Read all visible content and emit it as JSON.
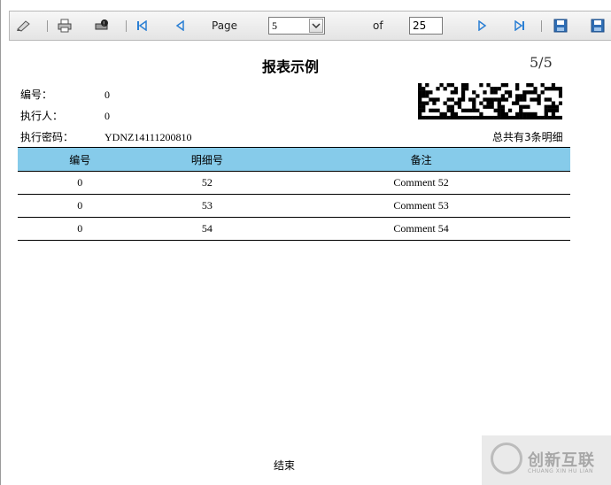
{
  "toolbar": {
    "page_label": "Page",
    "current_page": "5",
    "of_label": "of",
    "total_pages": "25"
  },
  "report": {
    "title": "报表示例",
    "page_indicator": "5/5",
    "fields": [
      {
        "label": "编号：",
        "value": "0"
      },
      {
        "label": "执行人：",
        "value": "0"
      },
      {
        "label": "执行密码：",
        "value": "YDNZ14111200810"
      }
    ],
    "summary": "总共有3条明细",
    "table": {
      "headers": [
        "编号",
        "明细号",
        "备注"
      ],
      "rows": [
        [
          "0",
          "52",
          "Comment 52"
        ],
        [
          "0",
          "53",
          "Comment 53"
        ],
        [
          "0",
          "54",
          "Comment 54"
        ]
      ]
    },
    "footer": "结束"
  },
  "watermark": {
    "brand": "创新互联",
    "sub": "CHUANG XIN HU LIAN"
  },
  "colors": {
    "header_bg": "#86cbea",
    "nav_blue": "#2a7fd4"
  }
}
